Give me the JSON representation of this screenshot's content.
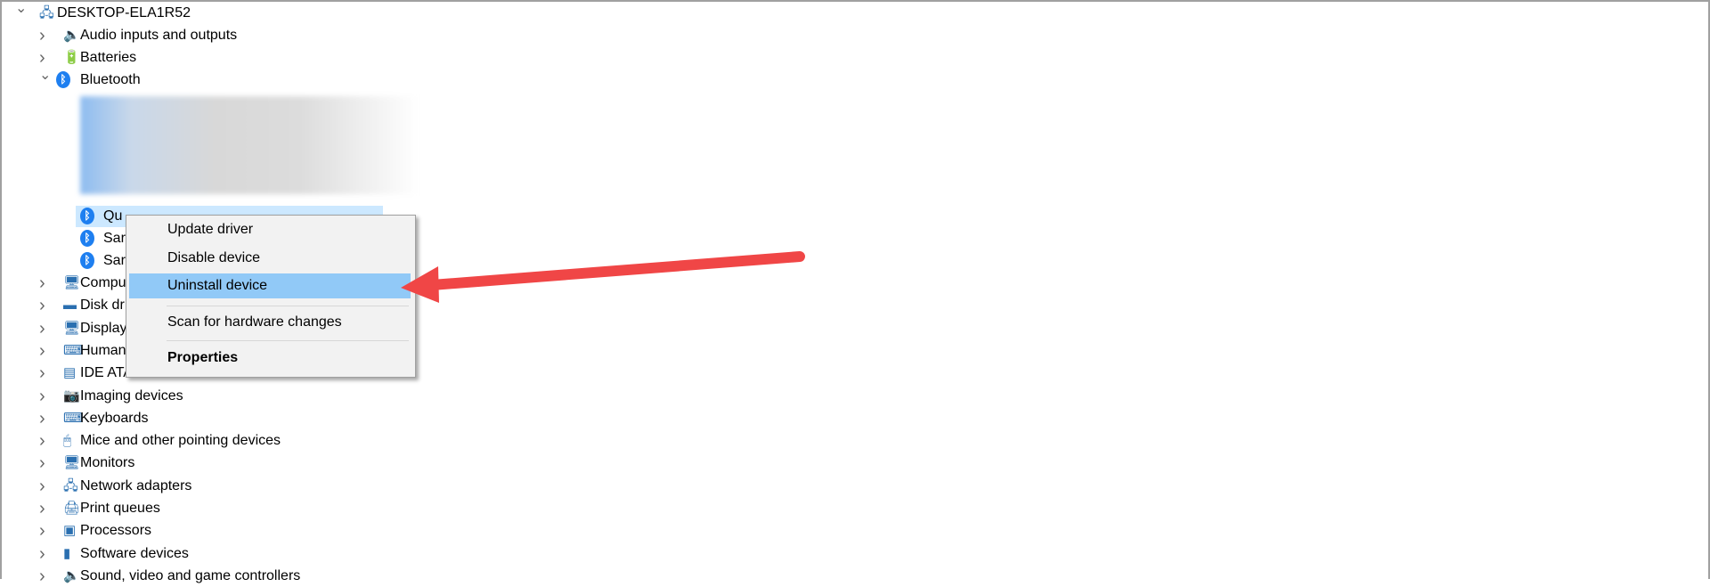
{
  "tree": {
    "root": {
      "label": "DESKTOP-ELA1R52",
      "icon": "computer-tower-icon",
      "expanded": true
    },
    "categories_before": [
      {
        "label": "Audio inputs and outputs",
        "icon": "speaker-icon"
      },
      {
        "label": "Batteries",
        "icon": "battery-icon"
      }
    ],
    "bluetooth": {
      "label": "Bluetooth",
      "icon": "bluetooth-icon",
      "expanded": true,
      "children": [
        {
          "label": "Qu"
        },
        {
          "label": "Sar"
        },
        {
          "label": "Sar"
        }
      ]
    },
    "categories_after": [
      {
        "label": "Compu",
        "icon": "computer-monitor-icon"
      },
      {
        "label": "Disk dr",
        "icon": "disk-drive-icon"
      },
      {
        "label": "Display",
        "icon": "display-adapter-icon"
      },
      {
        "label": "Human",
        "icon": "human-interface-icon"
      },
      {
        "label": "IDE ATA/ATAPI controllers",
        "icon": "ide-controller-icon"
      },
      {
        "label": "Imaging devices",
        "icon": "camera-icon"
      },
      {
        "label": "Keyboards",
        "icon": "keyboard-icon"
      },
      {
        "label": "Mice and other pointing devices",
        "icon": "mouse-icon"
      },
      {
        "label": "Monitors",
        "icon": "monitor-icon"
      },
      {
        "label": "Network adapters",
        "icon": "network-icon"
      },
      {
        "label": "Print queues",
        "icon": "printer-icon"
      },
      {
        "label": "Processors",
        "icon": "processor-icon"
      },
      {
        "label": "Software devices",
        "icon": "software-device-icon"
      },
      {
        "label": "Sound, video and game controllers",
        "icon": "sound-icon"
      }
    ]
  },
  "context_menu": {
    "items": [
      {
        "label": "Update driver"
      },
      {
        "label": "Disable device"
      },
      {
        "label": "Uninstall device",
        "highlighted": true
      },
      {
        "label": "Scan for hardware changes"
      },
      {
        "label": "Properties",
        "bold": true
      }
    ]
  },
  "annotation": {
    "arrow_color": "#f04646",
    "points_to": "Uninstall device"
  },
  "colors": {
    "highlight": "#91c9f7",
    "selection": "#cce8ff",
    "menu_bg": "#f2f2f2",
    "bluetooth": "#1e7ff0"
  }
}
